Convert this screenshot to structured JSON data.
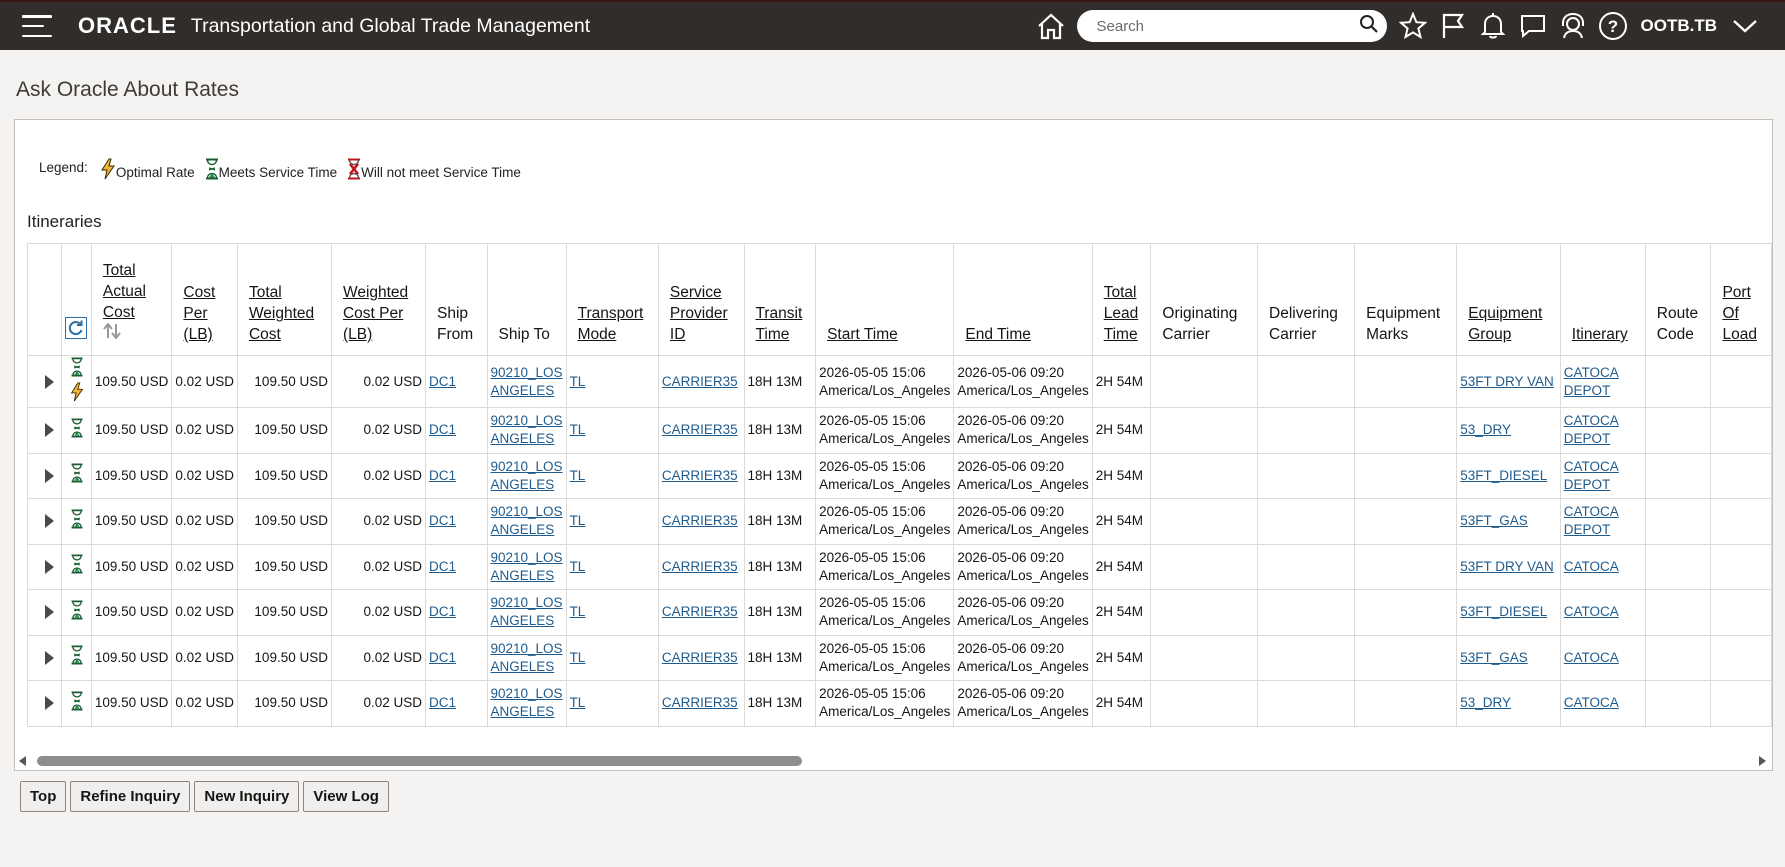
{
  "header": {
    "logo": "ORACLE",
    "app_title": "Transportation and Global Trade Management",
    "search_placeholder": "Search",
    "username": "OOTB.TB"
  },
  "page": {
    "title": "Ask Oracle About Rates"
  },
  "legend": {
    "label": "Legend:",
    "optimal": "Optimal Rate",
    "meets": "Meets Service Time",
    "not_meet": "Will not meet Service Time"
  },
  "section_title": "Itineraries",
  "columns": [
    {
      "label": "Total Actual Cost",
      "sortable": true
    },
    {
      "label": "Cost Per (LB)",
      "sortable": true
    },
    {
      "label": "Total Weighted Cost",
      "sortable": true
    },
    {
      "label": "Weighted Cost Per (LB)",
      "sortable": true
    },
    {
      "label": "Ship From",
      "sortable": false
    },
    {
      "label": "Ship To",
      "sortable": false
    },
    {
      "label": "Transport Mode",
      "sortable": true
    },
    {
      "label": "Service Provider ID",
      "sortable": true
    },
    {
      "label": "Transit Time",
      "sortable": true
    },
    {
      "label": "Start Time",
      "sortable": true
    },
    {
      "label": "End Time",
      "sortable": true
    },
    {
      "label": "Total Lead Time",
      "sortable": true
    },
    {
      "label": "Originating Carrier",
      "sortable": false
    },
    {
      "label": "Delivering Carrier",
      "sortable": false
    },
    {
      "label": "Equipment Marks",
      "sortable": false
    },
    {
      "label": "Equipment Group",
      "sortable": true
    },
    {
      "label": "Itinerary",
      "sortable": true
    },
    {
      "label": "Route Code",
      "sortable": false
    },
    {
      "label": "Port Of Load",
      "sortable": true
    }
  ],
  "rows": [
    {
      "optimal": true,
      "total_actual_cost": "109.50 USD",
      "cost_per_lb": "0.02 USD",
      "total_weighted_cost": "109.50 USD",
      "weighted_cost_per_lb": "0.02 USD",
      "ship_from": "DC1",
      "ship_to": "90210_LOS ANGELES",
      "transport_mode": "TL",
      "service_provider": "CARRIER35",
      "transit_time": "18H 13M",
      "start_time": "2026-05-05 15:06 America/Los_Angeles",
      "end_time": "2026-05-06 09:20 America/Los_Angeles",
      "total_lead_time": "2H 54M",
      "equipment_group": "53FT DRY VAN",
      "itinerary": "CATOCA DEPOT"
    },
    {
      "optimal": false,
      "total_actual_cost": "109.50 USD",
      "cost_per_lb": "0.02 USD",
      "total_weighted_cost": "109.50 USD",
      "weighted_cost_per_lb": "0.02 USD",
      "ship_from": "DC1",
      "ship_to": "90210_LOS ANGELES",
      "transport_mode": "TL",
      "service_provider": "CARRIER35",
      "transit_time": "18H 13M",
      "start_time": "2026-05-05 15:06 America/Los_Angeles",
      "end_time": "2026-05-06 09:20 America/Los_Angeles",
      "total_lead_time": "2H 54M",
      "equipment_group": "53_DRY",
      "itinerary": "CATOCA DEPOT"
    },
    {
      "optimal": false,
      "total_actual_cost": "109.50 USD",
      "cost_per_lb": "0.02 USD",
      "total_weighted_cost": "109.50 USD",
      "weighted_cost_per_lb": "0.02 USD",
      "ship_from": "DC1",
      "ship_to": "90210_LOS ANGELES",
      "transport_mode": "TL",
      "service_provider": "CARRIER35",
      "transit_time": "18H 13M",
      "start_time": "2026-05-05 15:06 America/Los_Angeles",
      "end_time": "2026-05-06 09:20 America/Los_Angeles",
      "total_lead_time": "2H 54M",
      "equipment_group": "53FT_DIESEL",
      "itinerary": "CATOCA DEPOT"
    },
    {
      "optimal": false,
      "total_actual_cost": "109.50 USD",
      "cost_per_lb": "0.02 USD",
      "total_weighted_cost": "109.50 USD",
      "weighted_cost_per_lb": "0.02 USD",
      "ship_from": "DC1",
      "ship_to": "90210_LOS ANGELES",
      "transport_mode": "TL",
      "service_provider": "CARRIER35",
      "transit_time": "18H 13M",
      "start_time": "2026-05-05 15:06 America/Los_Angeles",
      "end_time": "2026-05-06 09:20 America/Los_Angeles",
      "total_lead_time": "2H 54M",
      "equipment_group": "53FT_GAS",
      "itinerary": "CATOCA DEPOT"
    },
    {
      "optimal": false,
      "total_actual_cost": "109.50 USD",
      "cost_per_lb": "0.02 USD",
      "total_weighted_cost": "109.50 USD",
      "weighted_cost_per_lb": "0.02 USD",
      "ship_from": "DC1",
      "ship_to": "90210_LOS ANGELES",
      "transport_mode": "TL",
      "service_provider": "CARRIER35",
      "transit_time": "18H 13M",
      "start_time": "2026-05-05 15:06 America/Los_Angeles",
      "end_time": "2026-05-06 09:20 America/Los_Angeles",
      "total_lead_time": "2H 54M",
      "equipment_group": "53FT DRY VAN",
      "itinerary": "CATOCA"
    },
    {
      "optimal": false,
      "total_actual_cost": "109.50 USD",
      "cost_per_lb": "0.02 USD",
      "total_weighted_cost": "109.50 USD",
      "weighted_cost_per_lb": "0.02 USD",
      "ship_from": "DC1",
      "ship_to": "90210_LOS ANGELES",
      "transport_mode": "TL",
      "service_provider": "CARRIER35",
      "transit_time": "18H 13M",
      "start_time": "2026-05-05 15:06 America/Los_Angeles",
      "end_time": "2026-05-06 09:20 America/Los_Angeles",
      "total_lead_time": "2H 54M",
      "equipment_group": "53FT_DIESEL",
      "itinerary": "CATOCA"
    },
    {
      "optimal": false,
      "total_actual_cost": "109.50 USD",
      "cost_per_lb": "0.02 USD",
      "total_weighted_cost": "109.50 USD",
      "weighted_cost_per_lb": "0.02 USD",
      "ship_from": "DC1",
      "ship_to": "90210_LOS ANGELES",
      "transport_mode": "TL",
      "service_provider": "CARRIER35",
      "transit_time": "18H 13M",
      "start_time": "2026-05-05 15:06 America/Los_Angeles",
      "end_time": "2026-05-06 09:20 America/Los_Angeles",
      "total_lead_time": "2H 54M",
      "equipment_group": "53FT_GAS",
      "itinerary": "CATOCA"
    },
    {
      "optimal": false,
      "total_actual_cost": "109.50 USD",
      "cost_per_lb": "0.02 USD",
      "total_weighted_cost": "109.50 USD",
      "weighted_cost_per_lb": "0.02 USD",
      "ship_from": "DC1",
      "ship_to": "90210_LOS ANGELES",
      "transport_mode": "TL",
      "service_provider": "CARRIER35",
      "transit_time": "18H 13M",
      "start_time": "2026-05-05 15:06 America/Los_Angeles",
      "end_time": "2026-05-06 09:20 America/Los_Angeles",
      "total_lead_time": "2H 54M",
      "equipment_group": "53_DRY",
      "itinerary": "CATOCA"
    }
  ],
  "buttons": {
    "top": "Top",
    "refine": "Refine Inquiry",
    "new": "New Inquiry",
    "view_log": "View Log"
  },
  "colors": {
    "header_bg": "#312d2a",
    "link": "#1f5b8d",
    "hourglass_green": "#1b7a3a",
    "hourglass_red": "#c0141c",
    "bolt": "#e8a21a"
  }
}
